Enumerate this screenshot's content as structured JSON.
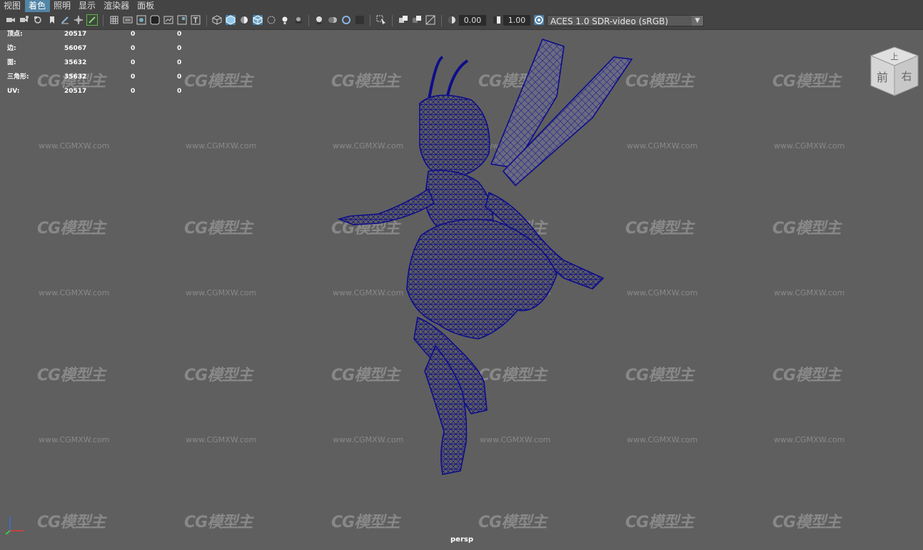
{
  "menubar": {
    "items": [
      {
        "label": "视图",
        "active": false
      },
      {
        "label": "着色",
        "active": true
      },
      {
        "label": "照明",
        "active": false
      },
      {
        "label": "显示",
        "active": false
      },
      {
        "label": "渲染器",
        "active": false
      },
      {
        "label": "面板",
        "active": false
      }
    ]
  },
  "toolbar": {
    "exposure_value": "0.00",
    "gamma_value": "1.00",
    "color_space": "ACES 1.0 SDR-video (sRGB)"
  },
  "hud": {
    "rows": [
      {
        "label": "顶点:",
        "v1": "20517",
        "v2": "0",
        "v3": "0"
      },
      {
        "label": "边:",
        "v1": "56067",
        "v2": "0",
        "v3": "0"
      },
      {
        "label": "面:",
        "v1": "35632",
        "v2": "0",
        "v3": "0"
      },
      {
        "label": "三角形:",
        "v1": "35632",
        "v2": "0",
        "v3": "0"
      },
      {
        "label": "UV:",
        "v1": "20517",
        "v2": "0",
        "v3": "0"
      }
    ]
  },
  "viewcube": {
    "top": "上",
    "front": "前",
    "right": "右"
  },
  "watermark": {
    "logo": "CG模型主",
    "url": "www.CGMXW.com"
  },
  "camera_label": "persp",
  "colors": {
    "wireframe": "#0d0d8a",
    "viewport_bg": "#5f5f5f",
    "accent": "#5285a6"
  }
}
